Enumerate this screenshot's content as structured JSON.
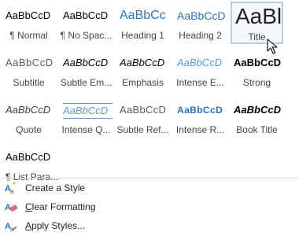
{
  "styles": [
    {
      "sample": "AaBbCcD",
      "label": "¶ Normal",
      "variant": "normal"
    },
    {
      "sample": "AaBbCcD",
      "label": "¶ No Spac...",
      "variant": "normal"
    },
    {
      "sample": "AaBbCc",
      "label": "Heading 1",
      "variant": "heading"
    },
    {
      "sample": "AaBbCcD",
      "label": "Heading 2",
      "variant": "heading2"
    },
    {
      "sample": "AaBl",
      "label": "Title",
      "variant": "title",
      "selected": true
    },
    {
      "sample": "AaBbCcD",
      "label": "Subtitle",
      "variant": "subtitle"
    },
    {
      "sample": "AaBbCcD",
      "label": "Subtle Em...",
      "variant": "italic"
    },
    {
      "sample": "AaBbCcD",
      "label": "Emphasis",
      "variant": "italic"
    },
    {
      "sample": "AaBbCcD",
      "label": "Intense E...",
      "variant": "accent"
    },
    {
      "sample": "AaBbCcD",
      "label": "Strong",
      "variant": "bold"
    },
    {
      "sample": "AaBbCcD",
      "label": "Quote",
      "variant": "quote"
    },
    {
      "sample": "AaBbCcD",
      "label": "Intense Q...",
      "variant": "intq"
    },
    {
      "sample": "AaBbCcD",
      "label": "Subtle Ref...",
      "variant": "subref"
    },
    {
      "sample": "AaBbCcD",
      "label": "Intense R...",
      "variant": "intref"
    },
    {
      "sample": "AaBbCcD",
      "label": "Book Title",
      "variant": "booktitle"
    },
    {
      "sample": "AaBbCcD",
      "label": "¶ List Para...",
      "variant": "normal"
    }
  ],
  "menu": {
    "create_style": {
      "prefix": "",
      "underlined": "",
      "text": "Create a Style",
      "icon": "create-style-icon"
    },
    "clear_formatting": {
      "prefix": "",
      "underlined": "C",
      "text": "lear Formatting",
      "icon": "clear-formatting-icon"
    },
    "apply_styles": {
      "prefix": "",
      "underlined": "A",
      "text": "pply Styles...",
      "icon": "apply-styles-icon"
    }
  },
  "colors": {
    "heading_blue": "#2e74b5",
    "accent_blue": "#5b9bd5",
    "selection_border": "#b6cde8"
  }
}
